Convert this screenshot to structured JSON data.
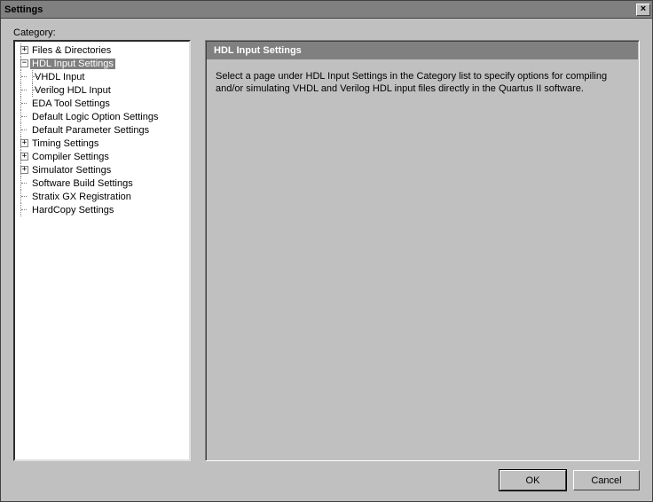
{
  "window": {
    "title": "Settings",
    "close_glyph": "×"
  },
  "category_label": "Category:",
  "tree": {
    "files_dirs": {
      "label": "Files & Directories",
      "toggle": "+"
    },
    "hdl_input": {
      "label": "HDL Input Settings",
      "toggle": "−"
    },
    "vhdl_input": {
      "label": "VHDL Input"
    },
    "verilog_input": {
      "label": "Verilog HDL Input"
    },
    "eda_tool": {
      "label": "EDA Tool Settings"
    },
    "default_logic": {
      "label": "Default Logic Option Settings"
    },
    "default_param": {
      "label": "Default Parameter Settings"
    },
    "timing": {
      "label": "Timing Settings",
      "toggle": "+"
    },
    "compiler": {
      "label": "Compiler Settings",
      "toggle": "+"
    },
    "simulator": {
      "label": "Simulator Settings",
      "toggle": "+"
    },
    "software_build": {
      "label": "Software Build Settings"
    },
    "stratix_gx": {
      "label": "Stratix GX Registration"
    },
    "hardcopy": {
      "label": "HardCopy Settings"
    }
  },
  "content": {
    "header": "HDL Input Settings",
    "body": "Select a page under HDL Input Settings in the Category list to specify options for compiling and/or simulating VHDL and Verilog HDL input files directly in the Quartus II software."
  },
  "buttons": {
    "ok": "OK",
    "cancel": "Cancel"
  }
}
